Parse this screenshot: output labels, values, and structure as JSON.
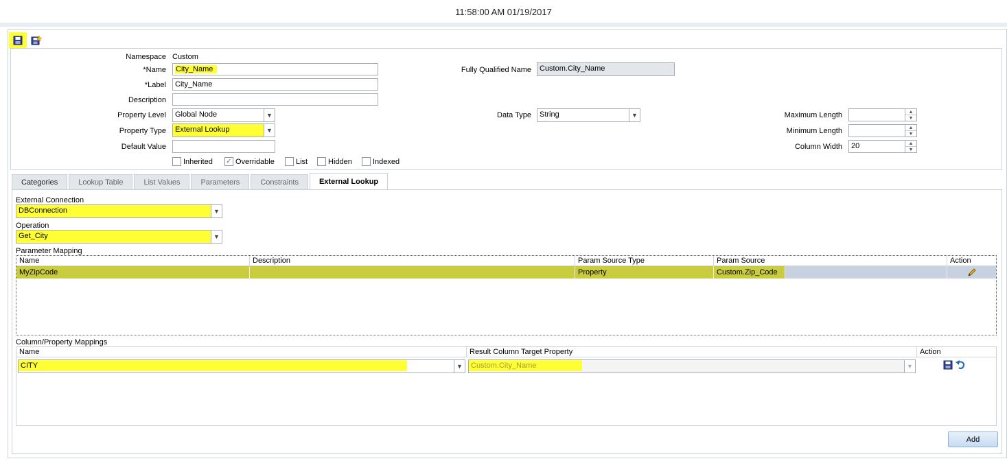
{
  "header": {
    "timestamp": "11:58:00 AM 01/19/2017"
  },
  "toolbar": {
    "save_icon": "save-icon",
    "save_as_icon": "save-as-icon"
  },
  "form": {
    "namespace_label": "Namespace",
    "namespace_value": "Custom",
    "name_label": "Name",
    "name_value": "City_Name",
    "label_label": "Label",
    "label_value": "City_Name",
    "description_label": "Description",
    "description_value": "",
    "property_level_label": "Property Level",
    "property_level_value": "Global Node",
    "property_type_label": "Property Type",
    "property_type_value": "External Lookup",
    "default_value_label": "Default Value",
    "default_value_value": "",
    "fqn_label": "Fully Qualified Name",
    "fqn_value": "Custom.City_Name",
    "data_type_label": "Data Type",
    "data_type_value": "String",
    "max_length_label": "Maximum Length",
    "max_length_value": "",
    "min_length_label": "Minimum Length",
    "min_length_value": "",
    "column_width_label": "Column Width",
    "column_width_value": "20",
    "required_marker": "*",
    "checkboxes": [
      {
        "label": "Inherited",
        "checked": false
      },
      {
        "label": "Overridable",
        "checked": true
      },
      {
        "label": "List",
        "checked": false
      },
      {
        "label": "Hidden",
        "checked": false
      },
      {
        "label": "Indexed",
        "checked": false
      }
    ]
  },
  "tabs": [
    "Categories",
    "Lookup Table",
    "List Values",
    "Parameters",
    "Constraints",
    "External Lookup"
  ],
  "external_lookup": {
    "connection_label": "External Connection",
    "connection_value": "DBConnection",
    "operation_label": "Operation",
    "operation_value": "Get_City",
    "param_mapping_label": "Parameter Mapping",
    "param_columns": [
      "Name",
      "Description",
      "Param Source Type",
      "Param Source",
      "Action"
    ],
    "param_rows": [
      {
        "name": "MyZipCode",
        "description": "",
        "source_type": "Property",
        "source": "Custom.Zip_Code",
        "action_icon": "pencil-icon"
      }
    ],
    "column_mapping_label": "Column/Property Mappings",
    "column_columns": [
      "Name",
      "Result Column Target Property",
      "Action"
    ],
    "column_rows": [
      {
        "name": "CITY",
        "target": "Custom.City_Name"
      }
    ],
    "add_label": "Add"
  },
  "colors": {
    "highlight": "#ffff33",
    "selected_row": "#c7d1e0",
    "panel_border": "#c9d3dd"
  }
}
